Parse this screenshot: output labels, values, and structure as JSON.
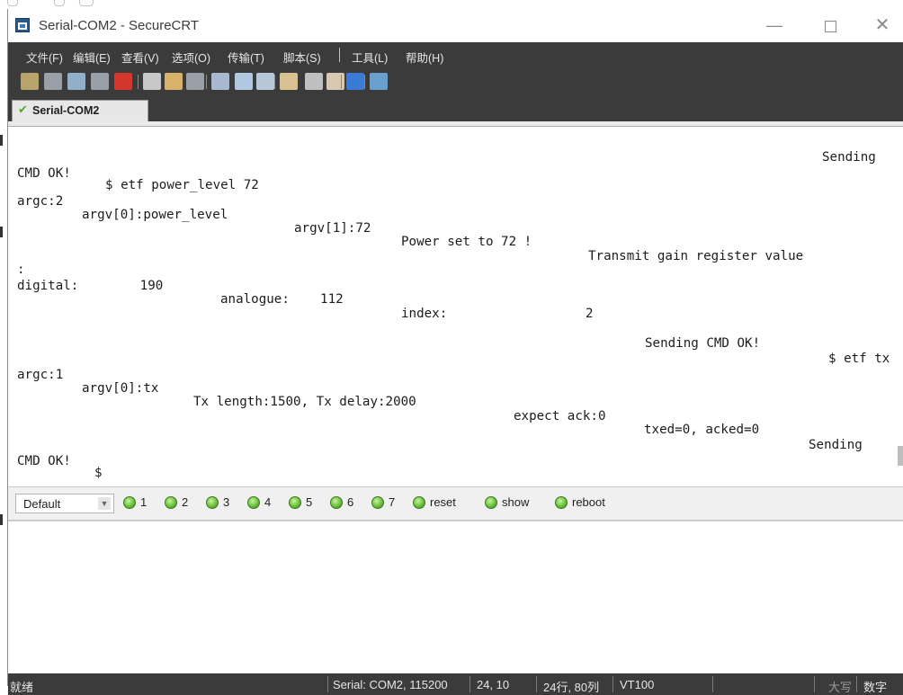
{
  "window": {
    "title": "Serial-COM2 - SecureCRT",
    "minimize_glyph": "—",
    "close_glyph": "✕"
  },
  "menu": [
    {
      "label": "文件(F)"
    },
    {
      "label": "编辑(E)"
    },
    {
      "label": "查看(V)"
    },
    {
      "label": "选项(O)"
    },
    {
      "label": "传输(T)"
    },
    {
      "label": "脚本(S)"
    },
    {
      "label": "工具(L)"
    },
    {
      "label": "帮助(H)"
    }
  ],
  "toolbar": {
    "icons": [
      "connect-icon",
      "quick-connect-icon",
      "connect-tab-icon",
      "reconnect-icon",
      "disconnect-icon",
      "copy-icon",
      "paste-icon",
      "find-icon",
      "print-icon",
      "print-selection-icon",
      "print-screen-icon",
      "session-options-icon",
      "global-options-icon",
      "keymap-icon",
      "help-icon",
      "sftp-icon"
    ],
    "colors": [
      "#b8a46a",
      "#9aa0a8",
      "#8fb0c8",
      "#9aa0a8",
      "#d4382c",
      "#c8c8c8",
      "#d8b26a",
      "#9aa0a8",
      "#a8b8d0",
      "#b0c8e0",
      "#b8c8d8",
      "#d8c090",
      "#c0c0c0",
      "#d8c8b0",
      "#3a7bd5",
      "#6aa0d0"
    ]
  },
  "tab": {
    "label": "Serial-COM2",
    "status_icon": "connected-check-icon",
    "status_color": "#5aa830"
  },
  "terminal": {
    "lines": [
      "Sending",
      "CMD OK!",
      "$ etf power_level 72",
      "argc:2",
      "argv[0]:power_level",
      "argv[1]:72",
      "Power set to 72 !",
      "Transmit gain register value",
      ":",
      "digital:        190",
      "analogue:    112",
      "index:                  2",
      "Sending CMD OK!",
      "$ etf tx",
      "argc:1",
      "argv[0]:tx",
      "Tx length:1500, Tx delay:2000",
      "expect ack:0",
      "txed=0, acked=0",
      "Sending",
      "CMD OK!",
      "$"
    ]
  },
  "button_bar": {
    "selected_value": "Default",
    "buttons": [
      {
        "label": "1"
      },
      {
        "label": "2"
      },
      {
        "label": "3"
      },
      {
        "label": "4"
      },
      {
        "label": "5"
      },
      {
        "label": "6"
      },
      {
        "label": "7"
      },
      {
        "label": "reset"
      },
      {
        "label": "show"
      },
      {
        "label": "reboot"
      }
    ],
    "button_color": "#6cc03c"
  },
  "status": {
    "ready": "就绪",
    "connection": "Serial: COM2, 115200",
    "cursor": "24,  10",
    "size": "24行, 80列",
    "emulation": "VT100",
    "caps": "大写",
    "num": "数字"
  }
}
